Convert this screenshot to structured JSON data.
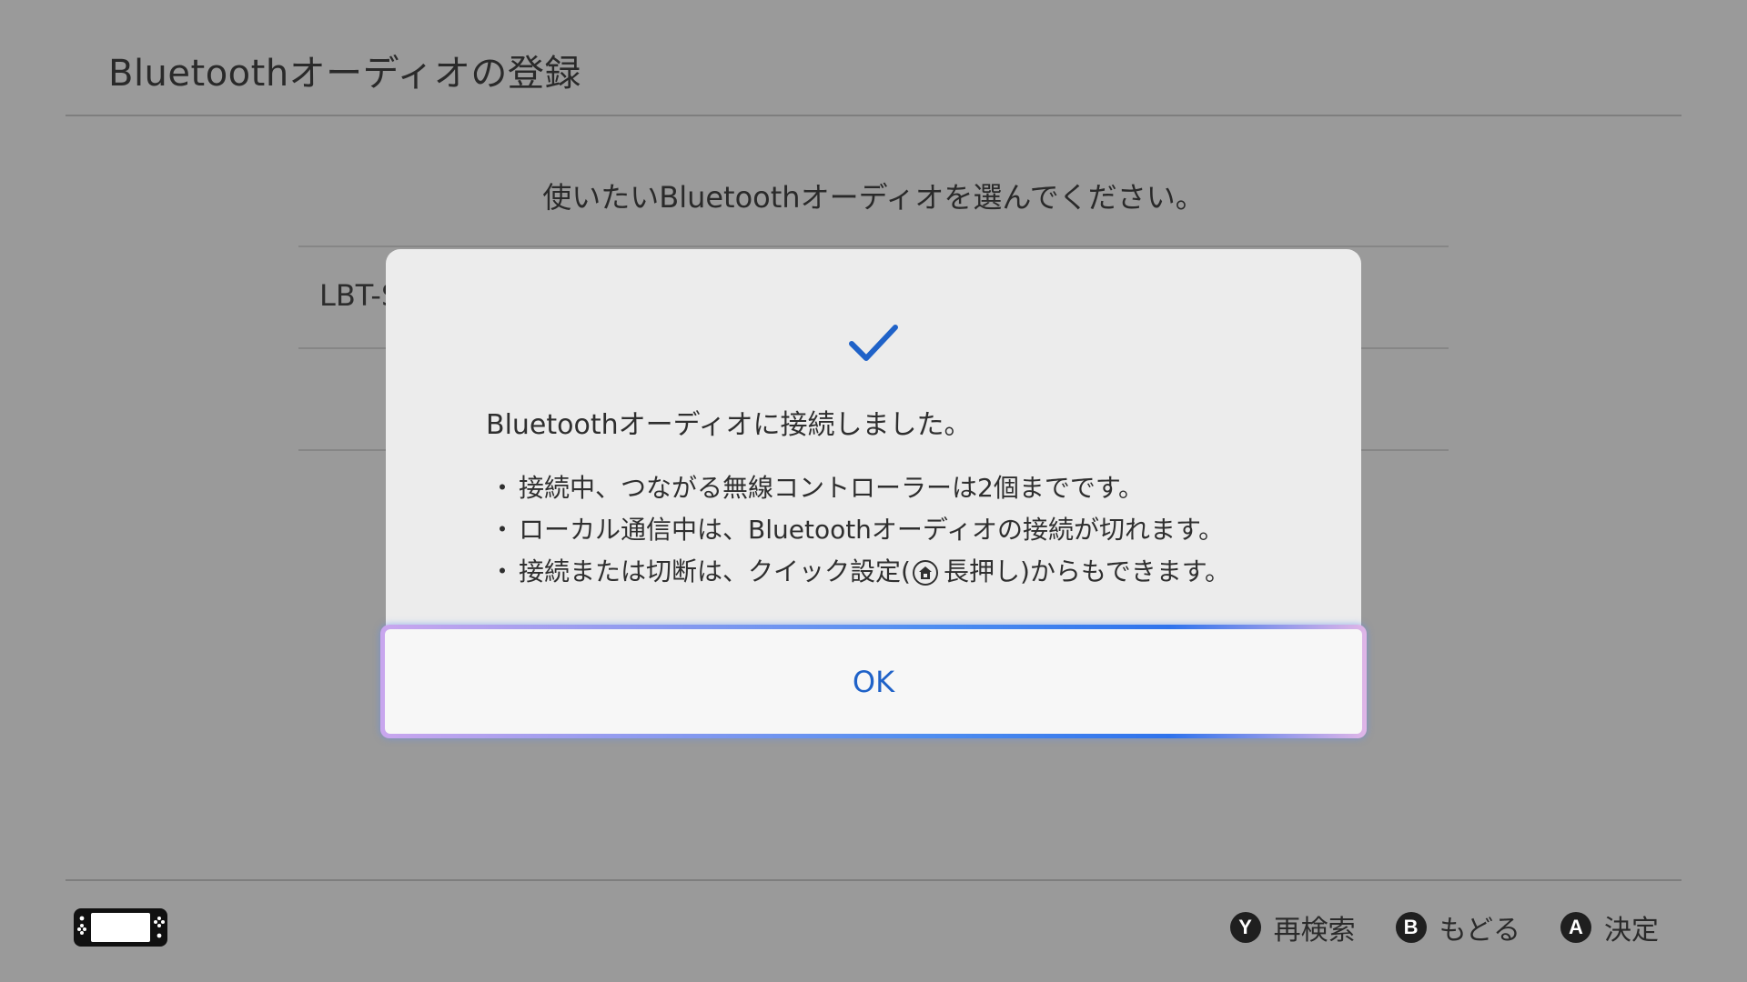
{
  "header": {
    "title": "Bluetoothオーディオの登録"
  },
  "main": {
    "instruction": "使いたいBluetoothオーディオを選んでください。",
    "device_list": [
      {
        "label": "LBT-S"
      }
    ]
  },
  "dialog": {
    "icon": "checkmark-icon",
    "message": "Bluetoothオーディオに接続しました。",
    "bullet_marker": "・",
    "bullets": [
      "接続中、つながる無線コントローラーは2個までです。",
      "ローカル通信中は、Bluetoothオーディオの接続が切れます。"
    ],
    "bullet3_prefix": "接続または切断は、クイック設定(",
    "bullet3_suffix": "長押し)からもできます。",
    "ok_label": "OK"
  },
  "footer": {
    "console_icon": "handheld-console-icon",
    "actions": [
      {
        "glyph": "Y",
        "label": "再検索"
      },
      {
        "glyph": "B",
        "label": "もどる"
      },
      {
        "glyph": "A",
        "label": "決定"
      }
    ]
  },
  "colors": {
    "accent": "#1f62c8",
    "background": "#9a9a9a",
    "dialog": "#ececec"
  }
}
